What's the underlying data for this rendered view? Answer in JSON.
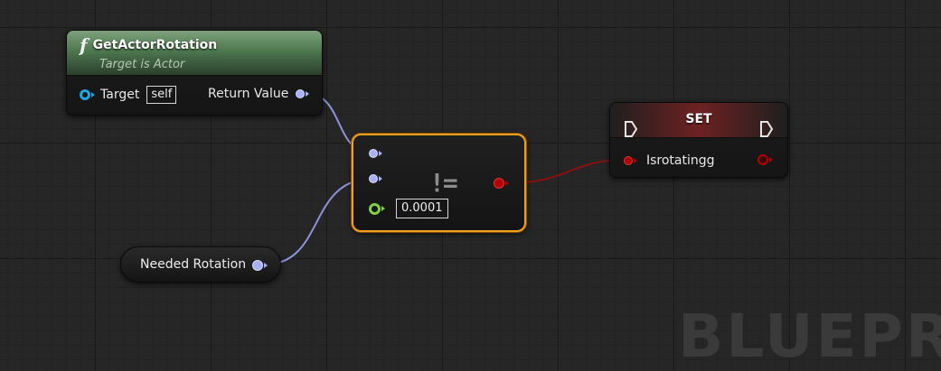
{
  "nodes": {
    "get_actor_rotation": {
      "title": "GetActorRotation",
      "subtitle": "Target is Actor",
      "glyph": "f",
      "target_label": "Target",
      "target_value": "self",
      "return_label": "Return Value",
      "header_color": "#4e7850"
    },
    "not_equal": {
      "operator": "!=",
      "tolerance_value": "0.0001",
      "border_color": "#f0a020"
    },
    "set": {
      "title": "SET",
      "variable_label": "Isrotatingg",
      "header_color": "#6e2121"
    },
    "needed_rotation": {
      "label": "Needed Rotation"
    }
  },
  "watermark": "BLUEPRI",
  "colors": {
    "rotator_pin": "#a9b1f5",
    "object_pin": "#1da6e0",
    "float_pin": "#83cf42",
    "bool_pin": "#b30000",
    "rotator_wire": "#8d93d8",
    "bool_wire": "#8a1010"
  }
}
